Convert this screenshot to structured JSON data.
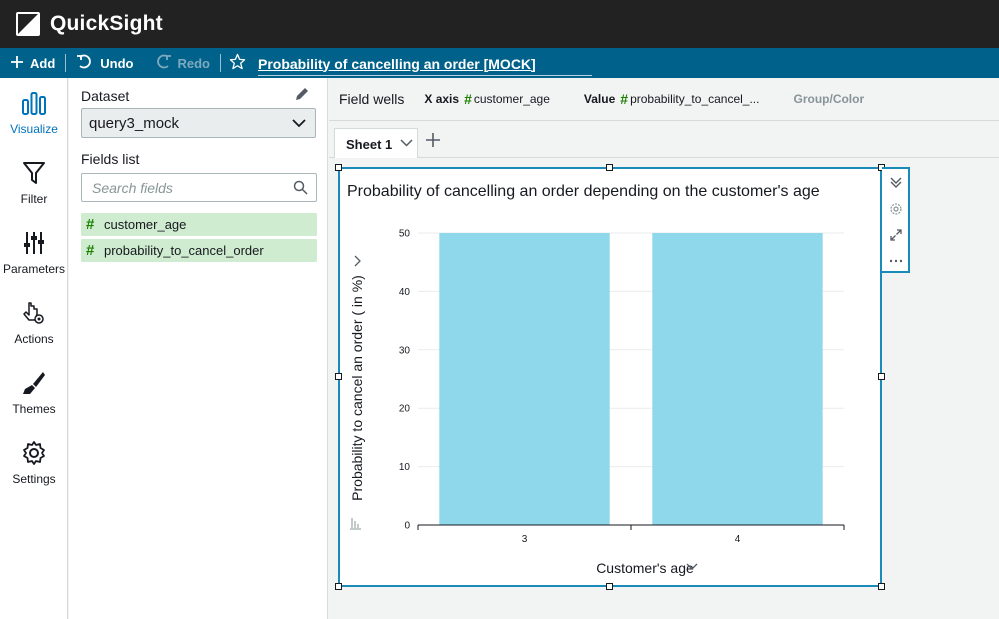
{
  "app": {
    "title": "QuickSight"
  },
  "toolbar": {
    "add_label": "Add",
    "undo_label": "Undo",
    "redo_label": "Redo",
    "analysis_name": "Probability of cancelling an order [MOCK]"
  },
  "rail": {
    "items": [
      {
        "label": "Visualize",
        "icon": "bar-chart-icon",
        "active": true
      },
      {
        "label": "Filter",
        "icon": "filter-icon"
      },
      {
        "label": "Parameters",
        "icon": "sliders-icon"
      },
      {
        "label": "Actions",
        "icon": "pointer-gear-icon"
      },
      {
        "label": "Themes",
        "icon": "paintbrush-icon"
      },
      {
        "label": "Settings",
        "icon": "gear-icon"
      }
    ]
  },
  "datapanel": {
    "dataset_label": "Dataset",
    "dataset_value": "query3_mock",
    "fields_label": "Fields list",
    "search_placeholder": "Search fields",
    "fields": [
      {
        "name": "customer_age"
      },
      {
        "name": "probability_to_cancel_order"
      }
    ]
  },
  "fieldwells": {
    "title": "Field wells",
    "x_label": "X axis",
    "x_value": "customer_age",
    "value_label": "Value",
    "value_value": "probability_to_cancel_...",
    "group_label": "Group/Color"
  },
  "sheets": {
    "tabs": [
      {
        "label": "Sheet 1"
      }
    ]
  },
  "visual": {
    "title": "Probability of cancelling an order depending on the customer's age"
  },
  "chart_data": {
    "type": "bar",
    "categories": [
      "3",
      "4"
    ],
    "values": [
      50,
      50
    ],
    "title": "Probability of cancelling an order depending on the customer's age",
    "xlabel": "Customer's age",
    "ylabel": "Probability to cancel an order ( in %)",
    "ylim": [
      0,
      50
    ],
    "yticks": [
      0,
      10,
      20,
      30,
      40,
      50
    ],
    "bar_color": "#8fd8ec",
    "grid": true,
    "legend": "none"
  },
  "colors": {
    "topbar": "#222222",
    "toolbar": "#00628a",
    "accent": "#1a8bb8",
    "field_bg": "#d0ecd0",
    "bar": "#8fd8ec"
  }
}
